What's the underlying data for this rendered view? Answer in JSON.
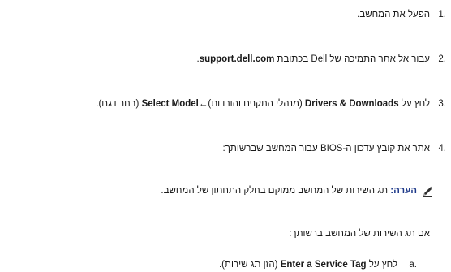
{
  "steps": [
    {
      "number": "1.",
      "text": "הפעל את המחשב."
    },
    {
      "number": "2.",
      "text_before": "עבור אל אתר התמיכה של Dell בכתובת ",
      "link": "support.dell.com",
      "text_after": "."
    },
    {
      "number": "3.",
      "prefix": "לחץ על ",
      "bold1": "Drivers & Downloads",
      "mid1": " (מנהלי התקנים והורדות)",
      "arrow": "←",
      "bold2": "Select Model",
      "suffix": " (בחר דגם)."
    },
    {
      "number": "4.",
      "text": "אתר את קובץ עדכון ה-BIOS עבור המחשב שברשותך:"
    }
  ],
  "note": {
    "icon": "pencil-note-icon",
    "label": "הערה:",
    "text": " תג השירות של המחשב ממוקם בחלק התחתון של המחשב."
  },
  "service_tag_intro": "אם תג השירות של המחשב ברשותך:",
  "substep_a": {
    "number": "a.",
    "prefix": "לחץ על ",
    "bold": "Enter a Service Tag",
    "suffix": " (הזן תג שירות)."
  }
}
